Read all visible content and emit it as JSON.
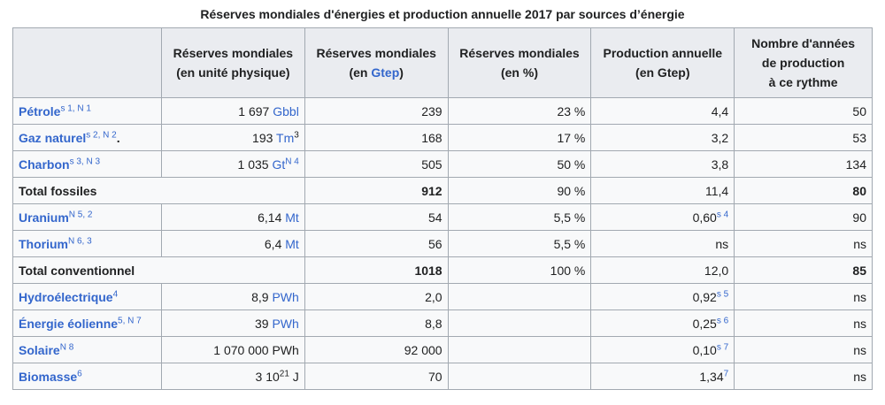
{
  "caption": "Réserves mondiales d'énergies et production annuelle 2017 par sources d’énergie",
  "headers": {
    "col1_line1": "Réserves mondiales",
    "col1_line2": "(en unité physique)",
    "col2_line1": "Réserves mondiales",
    "col2_pre": "(en ",
    "col2_link": "Gtep",
    "col2_post": ")",
    "col3_line1": "Réserves mondiales",
    "col3_line2": "(en %)",
    "col4_line1": "Production annuelle",
    "col4_line2": "(en Gtep)",
    "col5_line1": "Nombre d'années",
    "col5_line2": "de production",
    "col5_line3": "à ce rythme"
  },
  "rows": {
    "petrole": {
      "name": "Pétrole",
      "sup": "s 1, N 1",
      "phys_num": "1 697 ",
      "phys_unit": "Gbbl",
      "gtep": "239",
      "pct": "23 %",
      "prod": "4,4",
      "years": "50"
    },
    "gaz": {
      "name": "Gaz naturel",
      "sup": "s 2, N 2",
      "tail": ".",
      "phys_num": "193 ",
      "phys_unit": "Tm",
      "phys_unit_sup": "3",
      "gtep": "168",
      "pct": "17 %",
      "prod": "3,2",
      "years": "53"
    },
    "charbon": {
      "name": "Charbon",
      "sup": "s 3, N 3",
      "phys_num": "1 035 ",
      "phys_unit": "Gt",
      "phys_sup": "N 4",
      "gtep": "505",
      "pct": "50 %",
      "prod": "3,8",
      "years": "134"
    },
    "total_fossiles": {
      "name": "Total fossiles",
      "gtep": "912",
      "pct": "90 %",
      "prod": "11,4",
      "years": "80"
    },
    "uranium": {
      "name": "Uranium",
      "sup": "N 5, 2",
      "phys_num": "6,14 ",
      "phys_unit": "Mt",
      "gtep": "54",
      "pct": "5,5 %",
      "prod": "0,60",
      "prod_sup": "s 4",
      "years": "90"
    },
    "thorium": {
      "name": "Thorium",
      "sup": "N 6, 3",
      "phys_num": "6,4 ",
      "phys_unit": "Mt",
      "gtep": "56",
      "pct": "5,5 %",
      "prod": "ns",
      "years": "ns"
    },
    "total_conv": {
      "name": "Total conventionnel",
      "gtep": "1018",
      "pct": "100 %",
      "prod": "12,0",
      "years": "85"
    },
    "hydro": {
      "name": "Hydroélectrique",
      "sup": "4",
      "phys_num": "8,9 ",
      "phys_unit": "PWh",
      "gtep": "2,0",
      "pct": "",
      "prod": "0,92",
      "prod_sup": "s 5",
      "years": "ns"
    },
    "eolienne": {
      "name": "Énergie éolienne",
      "sup": "5, N 7",
      "phys_num": "39 ",
      "phys_unit": "PWh",
      "gtep": "8,8",
      "pct": "",
      "prod": "0,25",
      "prod_sup": "s 6",
      "years": "ns"
    },
    "solaire": {
      "name": "Solaire",
      "sup": "N 8",
      "phys_num": "1 070 000 PWh",
      "gtep": "92 000",
      "pct": "",
      "prod": "0,10",
      "prod_sup": "s 7",
      "years": "ns"
    },
    "biomasse": {
      "name": "Biomasse",
      "sup": "6",
      "phys_num": "3 10",
      "phys_exp": "21",
      "phys_tail": " J",
      "gtep": "70",
      "pct": "",
      "prod": "1,34",
      "prod_sup": "7",
      "years": "ns"
    }
  }
}
